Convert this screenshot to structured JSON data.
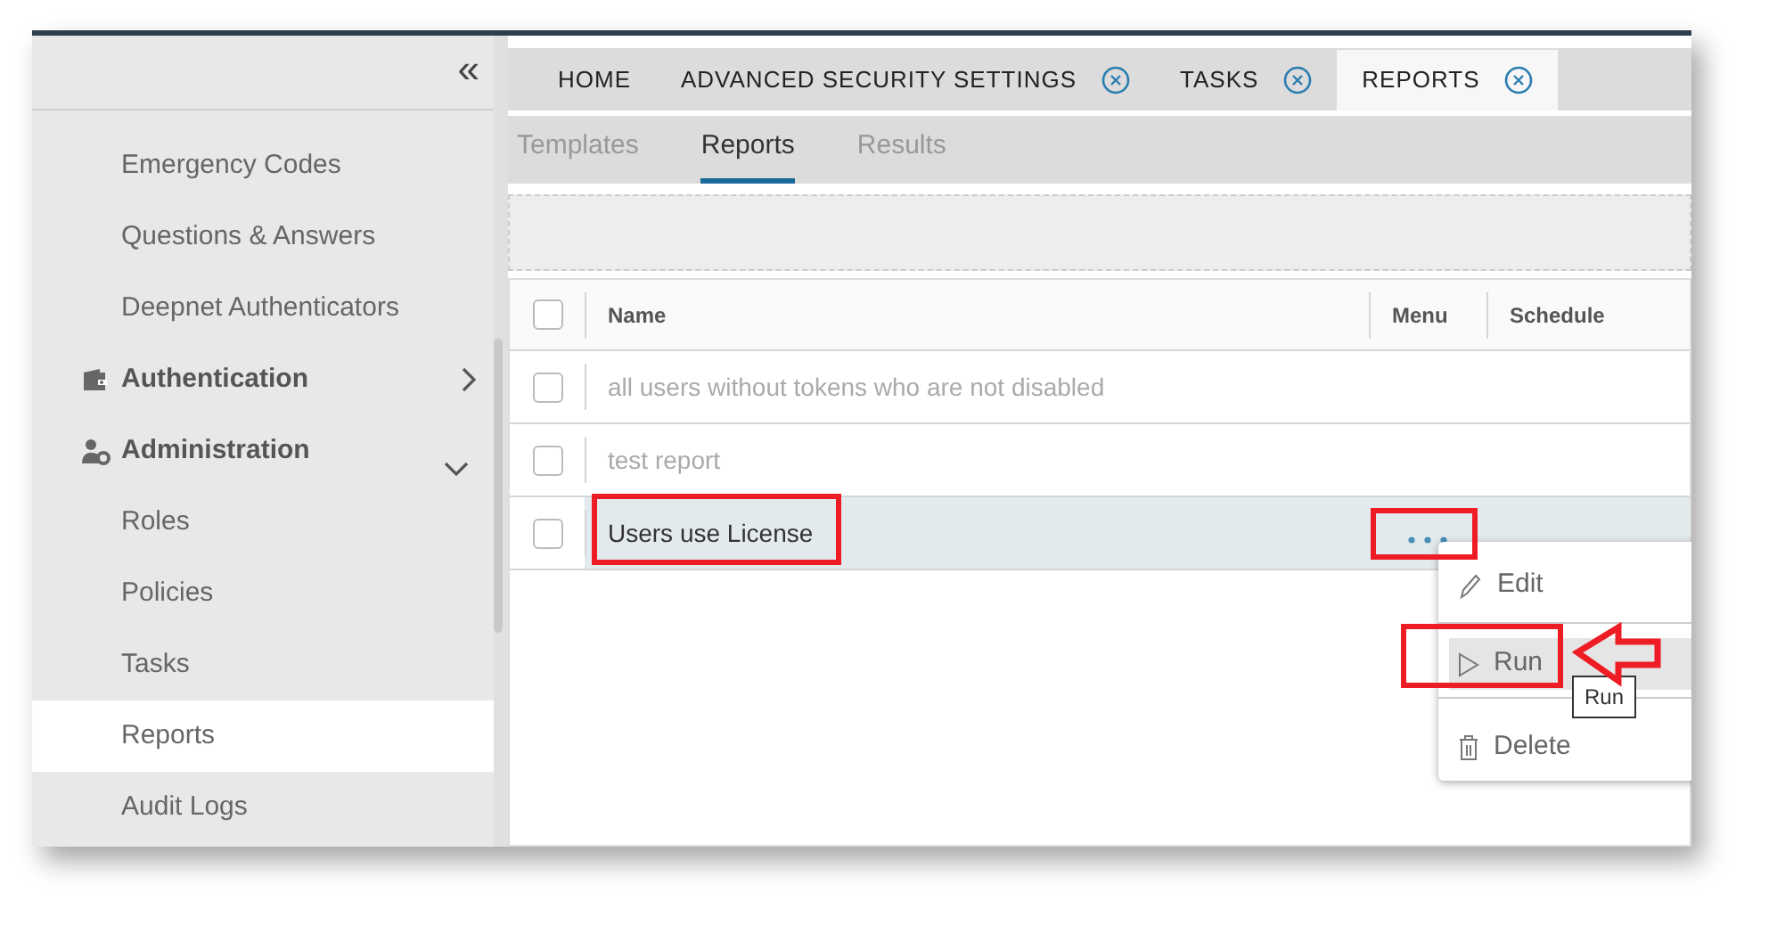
{
  "sidebar": {
    "collapse_icon": "«",
    "items": [
      {
        "kind": "item",
        "label": "Emergency Codes",
        "selected": false
      },
      {
        "kind": "item",
        "label": "Questions & Answers",
        "selected": false
      },
      {
        "kind": "item",
        "label": "Deepnet Authenticators",
        "selected": false
      },
      {
        "kind": "group",
        "label": "Authentication",
        "expanded": false
      },
      {
        "kind": "group",
        "label": "Administration",
        "expanded": true,
        "children": [
          {
            "kind": "item",
            "label": "Roles",
            "selected": false
          },
          {
            "kind": "item",
            "label": "Policies",
            "selected": false
          },
          {
            "kind": "item",
            "label": "Tasks",
            "selected": false
          },
          {
            "kind": "item",
            "label": "Reports",
            "selected": true
          },
          {
            "kind": "item",
            "label": "Audit Logs",
            "selected": false
          }
        ]
      }
    ]
  },
  "tabs": [
    {
      "label": "HOME",
      "closable": false,
      "selected": false
    },
    {
      "label": "ADVANCED SECURITY SETTINGS",
      "closable": true,
      "selected": false
    },
    {
      "label": "TASKS",
      "closable": true,
      "selected": false
    },
    {
      "label": "REPORTS",
      "closable": true,
      "selected": true
    }
  ],
  "sub_tabs": [
    {
      "label": "Templates",
      "selected": false
    },
    {
      "label": "Reports",
      "selected": true
    },
    {
      "label": "Results",
      "selected": false
    }
  ],
  "table": {
    "header_checked": false,
    "columns": [
      "Name",
      "Menu",
      "Schedule"
    ],
    "rows": [
      {
        "name": "all users without tokens who are not disabled",
        "checked": false,
        "disabled": true,
        "selected": false,
        "menu_shown": false,
        "name_highlighted": false,
        "menu_highlighted": false
      },
      {
        "name": "test report",
        "checked": false,
        "disabled": true,
        "selected": false,
        "menu_shown": false,
        "name_highlighted": false,
        "menu_highlighted": false
      },
      {
        "name": "Users use License",
        "checked": false,
        "disabled": false,
        "selected": true,
        "menu_shown": true,
        "name_highlighted": true,
        "menu_highlighted": true
      }
    ]
  },
  "row_menu": {
    "items": [
      {
        "kind": "edit",
        "label": "Edit",
        "selected": false,
        "highlighted": false,
        "arrow": false
      },
      {
        "kind": "run",
        "label": "Run",
        "selected": true,
        "highlighted": true,
        "arrow": true
      },
      {
        "kind": "delete",
        "label": "Delete",
        "selected": false,
        "highlighted": false,
        "arrow": false
      }
    ]
  },
  "tooltip": "Run"
}
